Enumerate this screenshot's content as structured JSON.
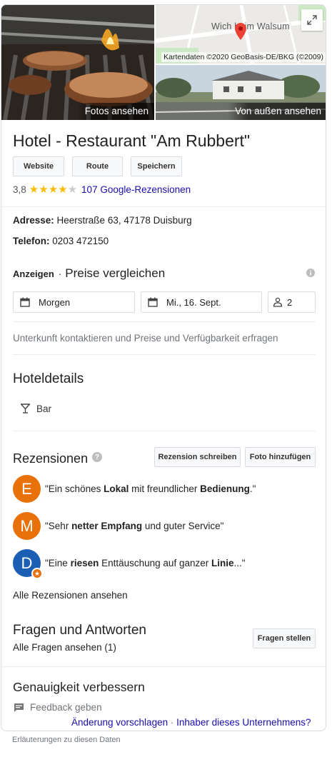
{
  "photos": {
    "grill_caption": "Fotos ansehen",
    "street_caption": "Von außen ansehen",
    "map_label": "Wich    heim Walsum",
    "map_credit": "Kartendaten ©2020 GeoBasis-DE/BKG (©2009)"
  },
  "title": "Hotel - Restaurant \"Am Rubbert\"",
  "actions": {
    "website": "Website",
    "route": "Route",
    "save": "Speichern"
  },
  "rating": {
    "value": "3,8",
    "stars": 3.8,
    "reviews_link": "107 Google-Rezensionen"
  },
  "address": {
    "label": "Adresse:",
    "value": "Heerstraße 63, 47178 Duisburg"
  },
  "phone": {
    "label": "Telefon:",
    "value": "0203 472150"
  },
  "prices": {
    "ads_label": "Anzeigen",
    "separator": "·",
    "heading": "Preise vergleichen",
    "checkin": "Morgen",
    "checkout": "Mi., 16. Sept.",
    "guests": "2",
    "contact_note": "Unterkunft kontaktieren und Preise und Verfügbarkeit erfragen"
  },
  "hotel_details": {
    "heading": "Hoteldetails",
    "amenity": "Bar"
  },
  "reviews": {
    "heading": "Rezensionen",
    "help_icon": "?",
    "write_button": "Rezension schreiben",
    "photo_button": "Foto hinzufügen",
    "items": [
      {
        "initial": "E",
        "color": "#e8710a",
        "pre": "\"Ein schönes ",
        "bold1": "Lokal",
        "mid": " mit freundlicher ",
        "bold2": "Bedienung",
        "post": ".\""
      },
      {
        "initial": "M",
        "color": "#e8710a",
        "pre": "\"Sehr ",
        "bold1": "netter Empfang",
        "mid": " und guter Service\"",
        "bold2": "",
        "post": ""
      },
      {
        "initial": "D",
        "color": "#1a5fb4",
        "pre": "\"Eine ",
        "bold1": "riesen",
        "mid": " Enttäuschung auf ganzer ",
        "bold2": "Linie",
        "post": "...\""
      }
    ],
    "all_link": "Alle Rezensionen ansehen"
  },
  "qa": {
    "heading": "Fragen und Antworten",
    "all_link": "Alle Fragen ansehen (1)",
    "ask_button": "Fragen stellen"
  },
  "accuracy": {
    "heading": "Genauigkeit verbessern",
    "feedback": "Feedback geben",
    "suggest_link": "Änderung vorschlagen",
    "dot": "·",
    "owner_link": "Inhaber dieses Unternehmens?"
  },
  "footer_note": "Erläuterungen zu diesen Daten",
  "colors": {
    "link": "#1a0dab",
    "star": "#fbbc04",
    "map_pin": "#ea4335",
    "avatar_orange": "#e8710a",
    "avatar_blue": "#1a5fb4"
  }
}
